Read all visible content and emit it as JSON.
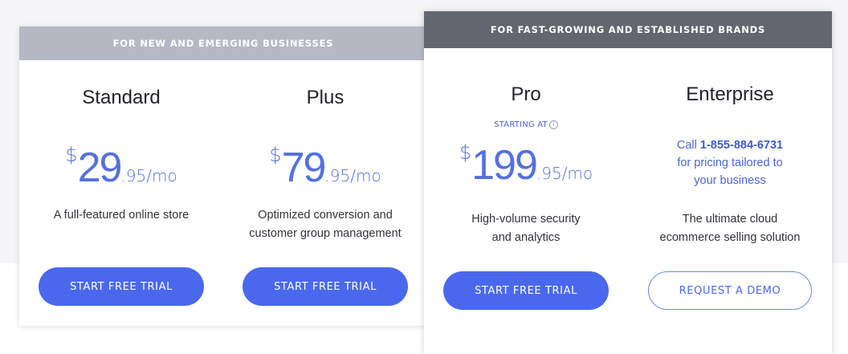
{
  "colors": {
    "accent": "#4a68ee",
    "price_text": "#5470e0",
    "left_header_bg": "#b6b9c3",
    "right_header_bg": "#64666f",
    "page_bg": "#f5f5f7"
  },
  "groups": [
    {
      "header": "FOR NEW AND EMERGING BUSINESSES",
      "plans": [
        {
          "name": "Standard",
          "price": {
            "currency": "$",
            "amount": "29",
            "cents": ".95/mo"
          },
          "description": [
            "A full-featured online store"
          ],
          "button": "START FREE TRIAL"
        },
        {
          "name": "Plus",
          "price": {
            "currency": "$",
            "amount": "79",
            "cents": ".95/mo"
          },
          "description": [
            "Optimized conversion and",
            "customer group management"
          ],
          "button": "START FREE TRIAL"
        }
      ]
    },
    {
      "header": "FOR FAST-GROWING AND ESTABLISHED BRANDS",
      "plans": [
        {
          "name": "Pro",
          "starting_at": "STARTING AT",
          "info_icon": "info-circle-icon",
          "price": {
            "currency": "$",
            "amount": "199",
            "cents": ".95/mo"
          },
          "description": [
            "High-volume security",
            "and analytics"
          ],
          "button": "START FREE TRIAL"
        },
        {
          "name": "Enterprise",
          "call": {
            "prefix": "Call",
            "phone": "1-855-884-6731",
            "line2": "for pricing tailored to",
            "line3": "your business"
          },
          "description": [
            "The ultimate cloud",
            "ecommerce selling solution"
          ],
          "button": "REQUEST A DEMO"
        }
      ]
    }
  ]
}
